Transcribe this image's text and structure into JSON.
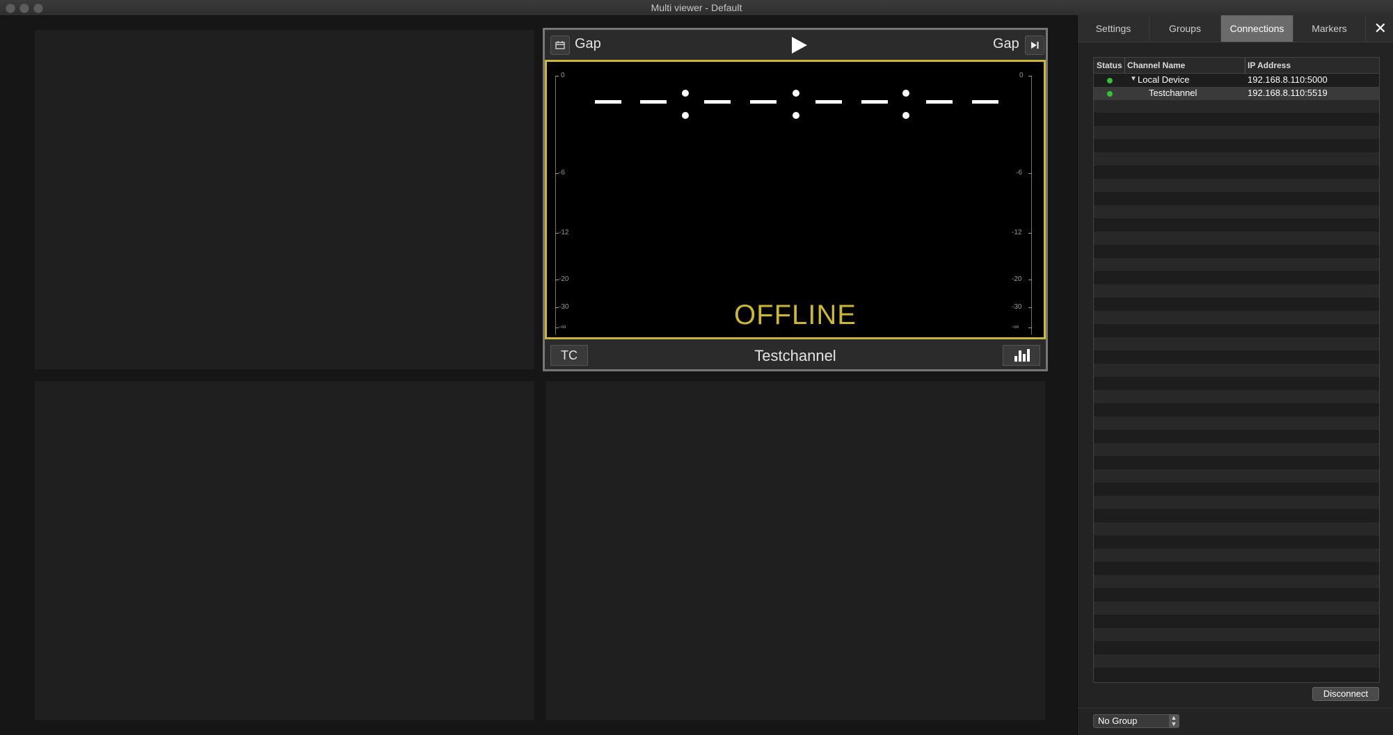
{
  "window": {
    "title": "Multi viewer - Default"
  },
  "active_tile": {
    "left_label": "Gap",
    "right_label": "Gap",
    "status": "OFFLINE",
    "tc_label": "TC",
    "channel_name": "Testchannel",
    "meter_ticks": [
      "0",
      "-6",
      "-12",
      "-20",
      "-30",
      "-∞"
    ]
  },
  "panel": {
    "tabs": [
      {
        "label": "Settings",
        "active": false
      },
      {
        "label": "Groups",
        "active": false
      },
      {
        "label": "Connections",
        "active": true
      },
      {
        "label": "Markers",
        "active": false
      }
    ],
    "close_icon": "✕",
    "columns": [
      "Status",
      "Channel Name",
      "IP Address"
    ],
    "rows": [
      {
        "status": "green",
        "name": "Local Device",
        "ip": "192.168.8.110:5000"
      },
      {
        "status": "green",
        "name": "Testchannel",
        "ip": "192.168.8.110:5519"
      }
    ],
    "disconnect_label": "Disconnect",
    "group_select": "No Group"
  },
  "colors": {
    "accent": "#c9b63a",
    "status_green": "#35c235"
  }
}
